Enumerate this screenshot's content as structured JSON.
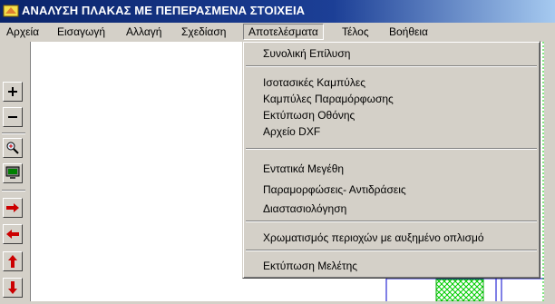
{
  "window": {
    "title": "ΑΝΑΛΥΣΗ ΠΛΑΚΑΣ ΜΕ ΠΕΠΕΡΑΣΜΕΝΑ ΣΤΟΙΧΕΙΑ"
  },
  "menubar": {
    "items": [
      {
        "label": "Αρχεία"
      },
      {
        "label": "Εισαγωγή"
      },
      {
        "label": "Αλλαγή"
      },
      {
        "label": "Σχεδίαση"
      },
      {
        "label": "Αποτελέσματα"
      },
      {
        "label": "Τέλος"
      },
      {
        "label": "Βοήθεια"
      }
    ]
  },
  "dropdown": {
    "groups": [
      [
        "Συνολική Επίλυση"
      ],
      [
        "Ισοτασικές Καμπύλες",
        "Καμπύλες Παραμόρφωσης",
        "Εκτύπωση Οθόνης",
        "Αρχείο DXF"
      ],
      [
        "Εντατικά Μεγέθη",
        "Παραμορφώσεις- Αντιδράσεις",
        "Διαστασιολόγηση"
      ],
      [
        "Χρωματισμός περιοχών με αυξημένο οπλισμό"
      ],
      [
        "Εκτύπωση Μελέτης"
      ]
    ]
  },
  "toolbar": {
    "buttons": [
      {
        "icon": "zoom-in-plus-icon"
      },
      {
        "icon": "zoom-out-minus-icon"
      },
      {
        "icon": "magnifier-icon"
      },
      {
        "icon": "monitor-icon"
      },
      {
        "icon": "arrow-right-icon"
      },
      {
        "icon": "arrow-left-icon"
      },
      {
        "icon": "arrow-up-icon"
      },
      {
        "icon": "arrow-down-icon"
      }
    ]
  },
  "colors": {
    "titlebar": "#0a246a",
    "arrows": "#cc0000",
    "grid_lines": "#0000cc",
    "hatch": "#00cc00"
  }
}
